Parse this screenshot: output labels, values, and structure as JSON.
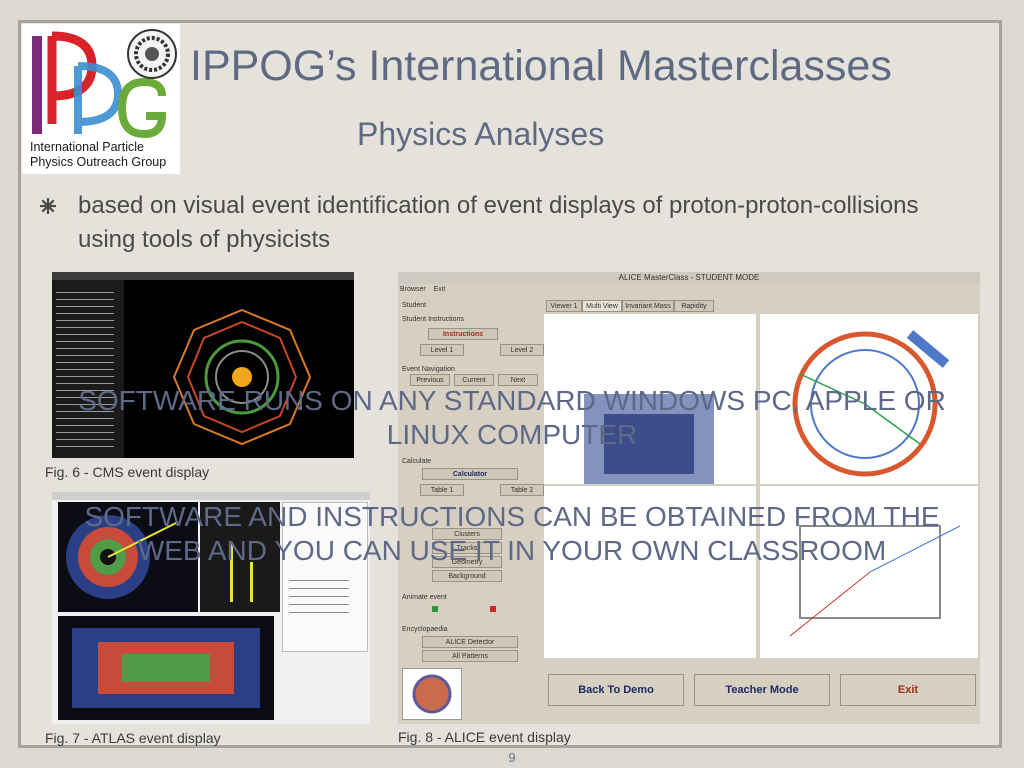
{
  "slide": {
    "title": "IPPOG’s International Masterclasses",
    "subtitle": "Physics Analyses",
    "logo": {
      "letters": [
        "I",
        "P",
        "P",
        "G"
      ],
      "tagline": [
        "International Particle",
        "Physics Outreach Group"
      ],
      "colors": {
        "I": "#7b2b78",
        "P1": "#d9222a",
        "P2": "#3b8fd2",
        "G": "#6bab3b"
      }
    },
    "bullet": "based on visual event identification of event displays of proton-proton-collisions using tools of physicists",
    "overlay_1": [
      "SOFTWARE RUNS ON ANY STANDARD WINDOWS PC, APPLE OR",
      "LINUX COMPUTER"
    ],
    "overlay_2": [
      "SOFTWARE AND INSTRUCTIONS CAN BE OBTAINED FROM THE",
      "WEB AND YOU CAN USE IT IN YOUR OWN CLASSROOM"
    ],
    "captions": {
      "cms": "Fig. 6 - CMS event display",
      "atlas": "Fig. 7 - ATLAS event display",
      "alice": "Fig. 8 - ALICE event display"
    },
    "page_number": "9",
    "alice_ui": {
      "window_title": "ALICE MasterClass - STUDENT MODE",
      "menu": [
        "Browser",
        "Exit"
      ],
      "tabs": [
        "Viewer 1",
        "Multi View",
        "Invariant Mass",
        "Rapidity"
      ],
      "student": "Student",
      "instructions_group": "Student Instructions",
      "instructions_button": "Instructions",
      "levels": [
        "Level 1",
        "Level 2"
      ],
      "event_navigation": "Event Navigation",
      "nav": [
        "Previous",
        "Current",
        "Next"
      ],
      "calculate": "Calculate",
      "calculator": "Calculator",
      "tables": [
        "Table 1",
        "Table 2"
      ],
      "clusters": "Clusters",
      "tracks": "Tracks",
      "geometry": "Geometry",
      "background": "Background",
      "animate_event": "Animate event",
      "encyclopaedia": "Encyclopaedia",
      "alice_detector": "ALICE Detector",
      "all_patterns": "All Patterns",
      "bottom_buttons": [
        "Back To Demo",
        "Teacher Mode",
        "Exit"
      ]
    }
  }
}
